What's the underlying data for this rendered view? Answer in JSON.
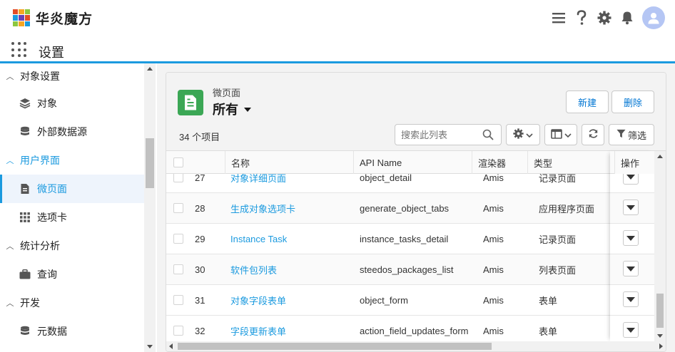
{
  "brand": {
    "name": "华炎魔方",
    "logo_colors": [
      "#e34c26",
      "#f6a623",
      "#8cc63f",
      "#1b9adf",
      "#6a3fb5",
      "#e34c26",
      "#8cc63f",
      "#f6a623",
      "#1b9adf"
    ]
  },
  "header": {
    "icons": [
      "menu-icon",
      "help-icon",
      "gear-icon",
      "bell-icon",
      "avatar"
    ]
  },
  "app": {
    "title": "设置"
  },
  "sidebar": {
    "groups": [
      {
        "label": "对象设置",
        "expanded": true,
        "active": false,
        "items": [
          {
            "label": "对象",
            "icon": "layers-icon"
          },
          {
            "label": "外部数据源",
            "icon": "database-icon"
          }
        ]
      },
      {
        "label": "用户界面",
        "expanded": true,
        "active": true,
        "items": [
          {
            "label": "微页面",
            "icon": "page-icon",
            "selected": true
          },
          {
            "label": "选项卡",
            "icon": "grid-icon"
          }
        ]
      },
      {
        "label": "统计分析",
        "expanded": true,
        "active": false,
        "items": [
          {
            "label": "查询",
            "icon": "briefcase-icon"
          }
        ]
      },
      {
        "label": "开发",
        "expanded": true,
        "active": false,
        "items": [
          {
            "label": "元数据",
            "icon": "database-icon"
          }
        ]
      }
    ]
  },
  "list": {
    "object_label": "微页面",
    "view_name": "所有",
    "new_label": "新建",
    "delete_label": "删除",
    "count": "34 个项目",
    "search_placeholder": "搜索此列表",
    "filter_label": "筛选",
    "columns": [
      "名称",
      "API Name",
      "渲染器",
      "类型",
      "操作"
    ],
    "rows": [
      {
        "num": "27",
        "name": "对象详细页面",
        "api": "object_detail",
        "renderer": "Amis",
        "type": "记录页面"
      },
      {
        "num": "28",
        "name": "生成对象选项卡",
        "api": "generate_object_tabs",
        "renderer": "Amis",
        "type": "应用程序页面"
      },
      {
        "num": "29",
        "name": "Instance Task",
        "api": "instance_tasks_detail",
        "renderer": "Amis",
        "type": "记录页面"
      },
      {
        "num": "30",
        "name": "软件包列表",
        "api": "steedos_packages_list",
        "renderer": "Amis",
        "type": "列表页面"
      },
      {
        "num": "31",
        "name": "对象字段表单",
        "api": "object_form",
        "renderer": "Amis",
        "type": "表单"
      },
      {
        "num": "32",
        "name": "字段更新表单",
        "api": "action_field_updates_form",
        "renderer": "Amis",
        "type": "表单"
      }
    ]
  },
  "colors": {
    "accent": "#1b9adf",
    "link": "#1b9adf",
    "object_icon_bg": "#3ba755",
    "button_text": "#0176d3"
  }
}
